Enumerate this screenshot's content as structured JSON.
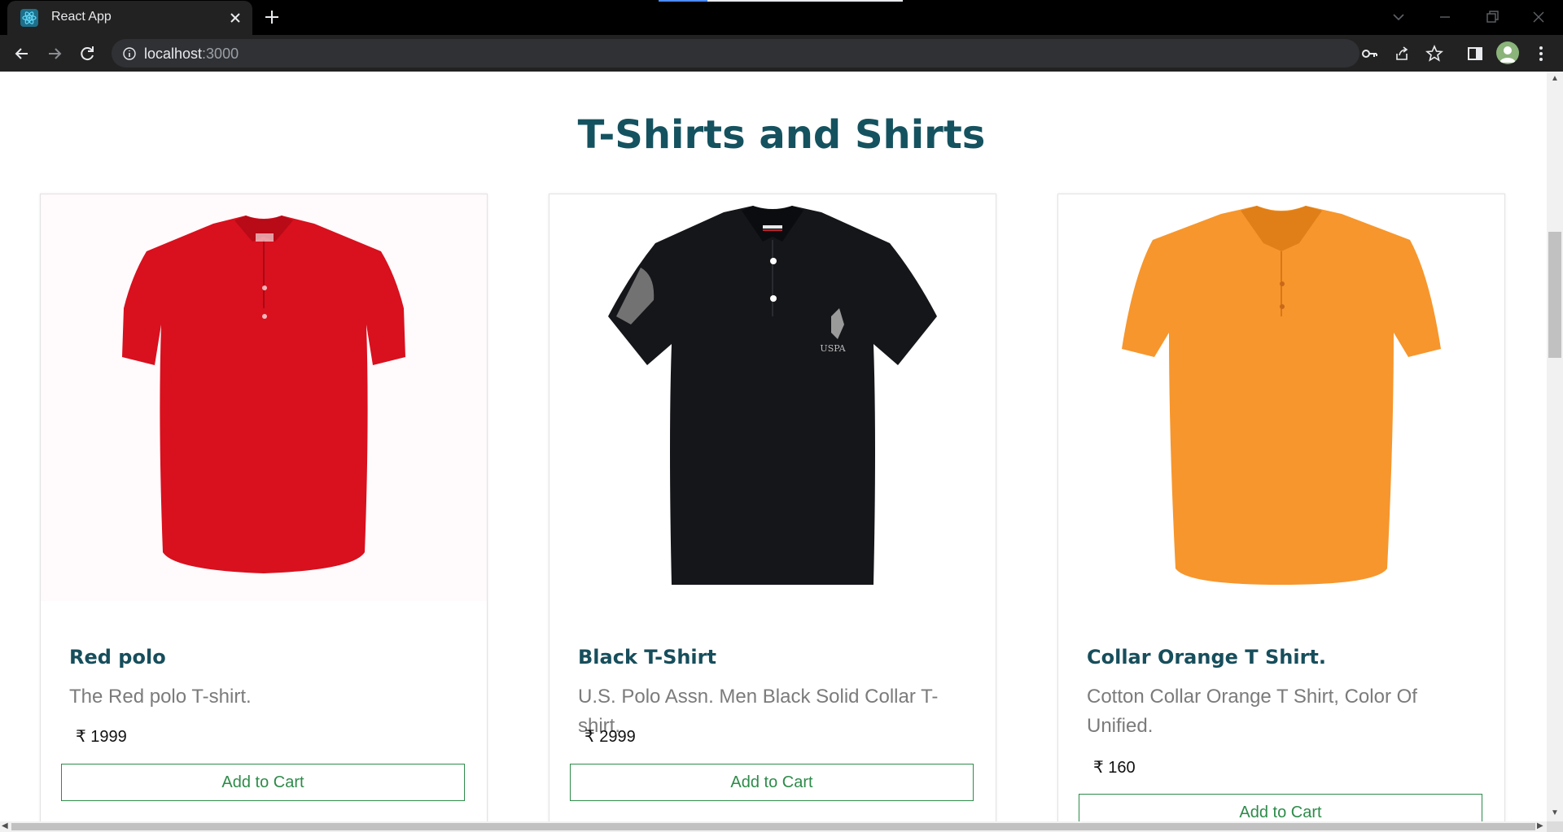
{
  "browser": {
    "tab_title": "React App",
    "url_host": "localhost",
    "url_port": ":3000",
    "favicon": "react-icon",
    "accent": "#61dafb"
  },
  "page": {
    "title": "T-Shirts and Shirts",
    "title_color": "#15525f"
  },
  "products": [
    {
      "name": "Red polo",
      "description": "The Red polo T-shirt.",
      "currency": "₹",
      "price": "1999",
      "button": "Add to Cart",
      "color": "#d9101e"
    },
    {
      "name": "Black T-Shirt",
      "description": "U.S. Polo Assn. Men Black Solid Collar T-shirt.",
      "currency": "₹",
      "price": "2999",
      "button": "Add to Cart",
      "color": "#15161a",
      "logo_text": "USPA"
    },
    {
      "name": "Collar Orange T Shirt.",
      "description": "Cotton Collar Orange T Shirt, Color Of Unified.",
      "currency": "₹",
      "price": "160",
      "button": "Add to Cart",
      "color": "#f7962c"
    }
  ]
}
